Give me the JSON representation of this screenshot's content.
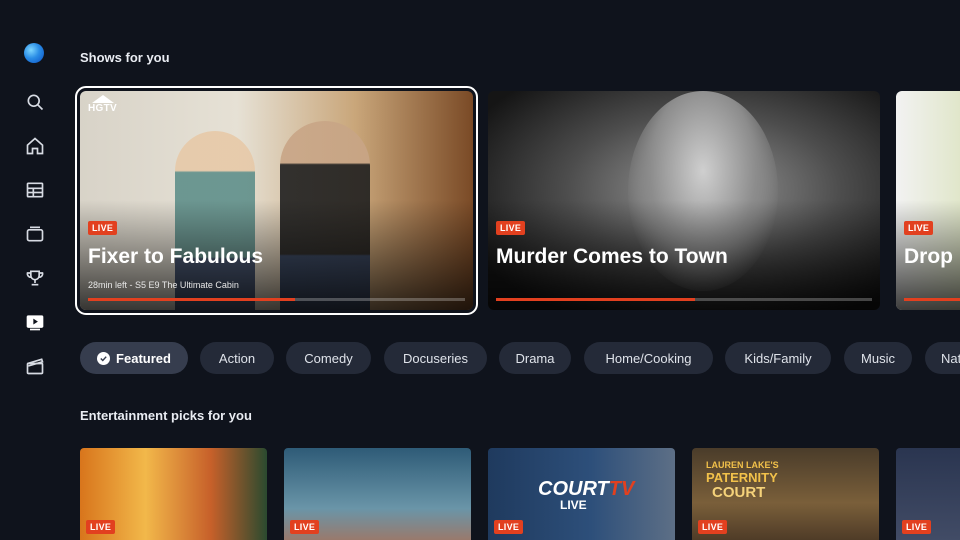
{
  "sidebar": {
    "items": [
      {
        "name": "search",
        "icon": "search-icon"
      },
      {
        "name": "home",
        "icon": "home-icon"
      },
      {
        "name": "guide",
        "icon": "grid-icon"
      },
      {
        "name": "live-tv",
        "icon": "tv-icon"
      },
      {
        "name": "sports",
        "icon": "trophy-icon"
      },
      {
        "name": "on-demand",
        "icon": "play-icon"
      },
      {
        "name": "movies",
        "icon": "clapper-icon"
      }
    ]
  },
  "shows_section": {
    "title": "Shows for you",
    "cards": [
      {
        "badge": "LIVE",
        "network": "HGTV",
        "title": "Fixer to Fabulous",
        "meta": "28min left - S5 E9 The Ultimate Cabin",
        "progress": 0.55
      },
      {
        "badge": "LIVE",
        "title": "Murder Comes to Town",
        "meta": "",
        "progress": 0.53
      },
      {
        "badge": "LIVE",
        "title": "Drop",
        "meta": "",
        "progress": 0.6
      }
    ]
  },
  "genres": {
    "items": [
      "Featured",
      "Action",
      "Comedy",
      "Docuseries",
      "Drama",
      "Home/Cooking",
      "Kids/Family",
      "Music",
      "Nat"
    ],
    "active": "Featured"
  },
  "picks_section": {
    "title": "Entertainment picks for you",
    "posters": [
      {
        "badge": "LIVE"
      },
      {
        "badge": "LIVE"
      },
      {
        "badge": "LIVE",
        "logo_main": "COURT",
        "logo_tv": "TV",
        "logo_sub": "LIVE"
      },
      {
        "badge": "LIVE",
        "line1": "LAUREN LAKE'S",
        "line2": "PATERNITY",
        "line3": "COURT"
      },
      {
        "badge": "LIVE"
      }
    ]
  },
  "colors": {
    "accent": "#e2401f",
    "background": "#0f131c",
    "chip": "#242a38"
  }
}
